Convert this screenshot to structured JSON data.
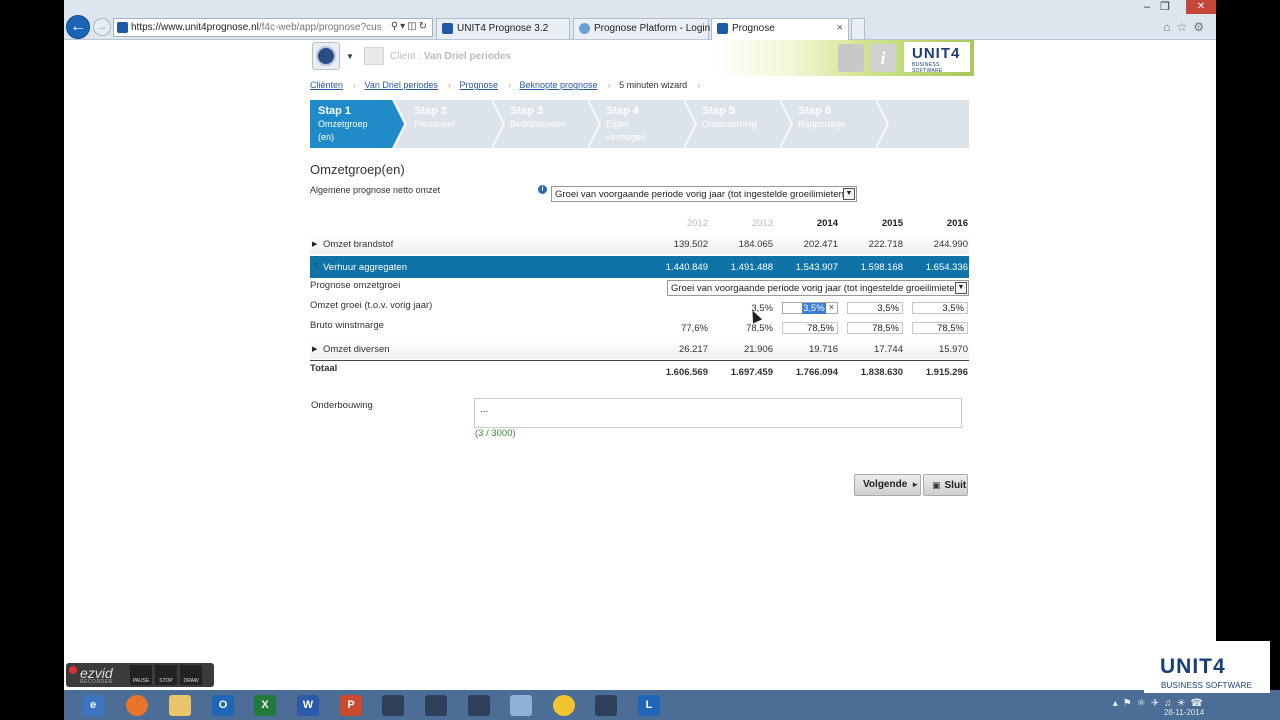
{
  "browser": {
    "url_main": "https://www.unit4prognose.nl",
    "url_rest": "/f4c-web/app/prognose?customerid=1",
    "tabs": [
      {
        "label": "UNIT4 Prognose 3.2"
      },
      {
        "label": "Prognose Platform - Login"
      },
      {
        "label": "Prognose"
      }
    ]
  },
  "header": {
    "client_prefix": "Client :",
    "client_name": "Van Driel periodes",
    "brand": "UNIT4",
    "brand_sub": "BUSINESS SOFTWARE"
  },
  "breadcrumb": [
    "Cliënten",
    "Van Driel periodes",
    "Prognose",
    "Beknopte prognose",
    "5 minuten wizard"
  ],
  "steps": [
    {
      "title": "Stap 1",
      "label1": "Omzetgroep",
      "label2": "(en)"
    },
    {
      "title": "Stap 2",
      "label1": "Personeel",
      "label2": ""
    },
    {
      "title": "Stap 3",
      "label1": "Bedrijfskosten",
      "label2": ""
    },
    {
      "title": "Stap 4",
      "label1": "Eigen",
      "label2": "vermogen"
    },
    {
      "title": "Stap 5",
      "label1": "Onderneming",
      "label2": ""
    },
    {
      "title": "Stap 6",
      "label1": "Rapportage",
      "label2": ""
    }
  ],
  "main": {
    "title": "Omzetgroep(en)",
    "general_label": "Algemene prognose netto omzet",
    "general_select": "Groei van voorgaande periode vorig jaar (tot ingestelde groeilimieten)",
    "years": [
      "2012",
      "2013",
      "2014",
      "2015",
      "2016"
    ],
    "rows": {
      "brandstof": {
        "label": "Omzet brandstof",
        "values": [
          "139.502",
          "184.065",
          "202.471",
          "222.718",
          "244.990"
        ]
      },
      "aggregaten": {
        "label": "Verhuur aggregaten",
        "values": [
          "1.440.849",
          "1.491.488",
          "1.543.907",
          "1.598.168",
          "1.654.336"
        ]
      },
      "prognose": {
        "label": "Prognose omzetgroei",
        "select": "Groei van voorgaande periode vorig jaar (tot ingestelde groeilimieten)"
      },
      "groei": {
        "label": "Omzet groei (t.o.v. vorig jaar)",
        "value_2013": "3,5%",
        "inputs": [
          "3,5%",
          "3,5%",
          "3,5%"
        ]
      },
      "marge": {
        "label": "Bruto winstmarge",
        "value_2012": "77,6%",
        "value_2013": "78,5%",
        "inputs": [
          "78,5%",
          "78,5%",
          "78,5%"
        ]
      },
      "diversen": {
        "label": "Omzet diversen",
        "values": [
          "26.217",
          "21.906",
          "19.716",
          "17.744",
          "15.970"
        ]
      },
      "totaal": {
        "label": "Totaal",
        "values": [
          "1.606.569",
          "1.697.459",
          "1.766.094",
          "1.838.630",
          "1.915.296"
        ]
      }
    },
    "onderbouwing_label": "Onderbouwing",
    "onderbouwing_value": "...",
    "onderbouwing_count": "(3 / 3000)",
    "btn_next": "Volgende",
    "btn_close": "Sluit"
  },
  "taskbar": {
    "clock": "28-11-2014",
    "watermark_brand": "UNIT4",
    "watermark_sub": "BUSINESS SOFTWARE",
    "ezvid_logo": "ezvid",
    "ezvid_sub": "RECORDER",
    "ezvid_buttons": [
      "PAUSE",
      "STOP",
      "DRAW"
    ]
  }
}
